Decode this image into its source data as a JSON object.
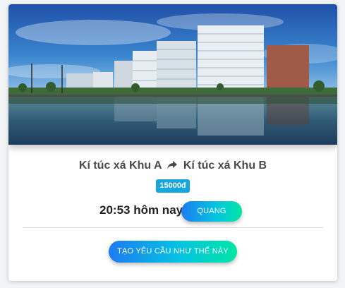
{
  "trip": {
    "from": "Kí túc xá Khu A",
    "to": "Kí túc xá Khu B",
    "price": "15000đ",
    "time": "20:53 hôm nay",
    "driver_label": "QUANG",
    "create_label": "TẠO YÊU CẦU NHƯ THẾ NÀY"
  },
  "icons": {
    "route_arrow": "share-arrow-icon"
  },
  "colors": {
    "price_badge": "#16a5dd",
    "button_gradient_start": "#1e7bf0",
    "button_gradient_end": "#00e6a4",
    "title_text": "#4a4a4a"
  }
}
